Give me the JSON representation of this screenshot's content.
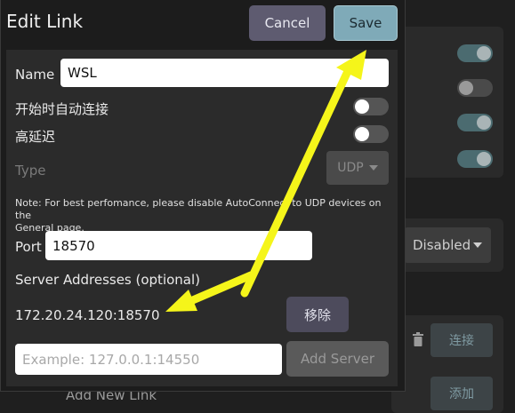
{
  "dialog": {
    "title": "Edit Link",
    "cancel_label": "Cancel",
    "save_label": "Save",
    "name_label": "Name",
    "name_value": "WSL",
    "auto_connect_label": "开始时自动连接",
    "auto_connect_on": false,
    "high_latency_label": "高延迟",
    "high_latency_on": false,
    "type_label": "Type",
    "type_value": "UDP",
    "note_line1": "Note: For best perfomance, please disable AutoConnect to UDP devices on the",
    "note_line2": "General page.",
    "port_label": "Port",
    "port_value": "18570",
    "server_addresses_label": "Server Addresses (optional)",
    "server_address": "172.20.24.120:18570",
    "remove_label": "移除",
    "server_input_placeholder": "Example: 127.0.0.1:14550",
    "add_server_label": "Add Server"
  },
  "background": {
    "toggles": [
      true,
      false,
      true,
      true
    ],
    "select_value": "Disabled",
    "connect_label": "连接",
    "add_label": "添加",
    "add_new_link_text": "Add New Link"
  },
  "colors": {
    "annotation_arrow": "#f5f51a",
    "save_button": "#7faab8",
    "cancel_button": "#5e5b70"
  },
  "icons": [
    "trash-icon",
    "chevron-down-icon",
    "arrow-annotation"
  ]
}
